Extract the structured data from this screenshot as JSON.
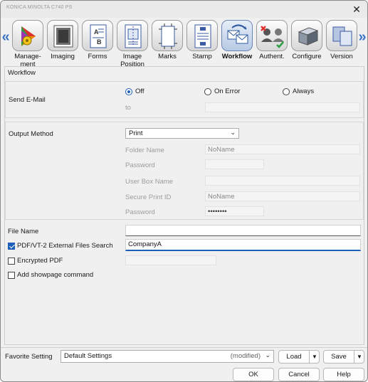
{
  "window": {
    "title": "KONICA MINOLTA C740 PS",
    "close_glyph": "✕"
  },
  "tabs": [
    {
      "label": "Manage-\nment",
      "icon": "management-icon",
      "active": false
    },
    {
      "label": "Imaging",
      "icon": "imaging-icon",
      "active": false
    },
    {
      "label": "Forms",
      "icon": "forms-icon",
      "active": false
    },
    {
      "label": "Image\nPosition",
      "icon": "image-position-icon",
      "active": false
    },
    {
      "label": "Marks",
      "icon": "marks-icon",
      "active": false
    },
    {
      "label": "Stamp",
      "icon": "stamp-icon",
      "active": false
    },
    {
      "label": "Workflow",
      "icon": "workflow-icon",
      "active": true
    },
    {
      "label": "Authent.",
      "icon": "authentication-icon",
      "active": false
    },
    {
      "label": "Configure",
      "icon": "configure-icon",
      "active": false
    },
    {
      "label": "Version",
      "icon": "version-icon",
      "active": false
    }
  ],
  "nav": {
    "left": "«",
    "right": "»"
  },
  "section_title": "Workflow",
  "send_email": {
    "label": "Send E-Mail",
    "options": [
      "Off",
      "On Error",
      "Always"
    ],
    "selected": "Off",
    "to_label": "to",
    "to_value": ""
  },
  "output_method": {
    "label": "Output Method",
    "value": "Print",
    "folder_name_label": "Folder Name",
    "folder_name_value": "NoName",
    "password_label": "Password",
    "password_value": "",
    "user_box_label": "User Box Name",
    "user_box_value": "",
    "secure_print_label": "Secure Print ID",
    "secure_print_value": "NoName",
    "secure_password_label": "Password",
    "secure_password_value": "••••••••"
  },
  "file_name": {
    "label": "File Name",
    "value": ""
  },
  "pdf_search": {
    "label": "PDF/VT-2 External Files Search",
    "checked": true,
    "value": "CompanyA"
  },
  "encrypted_pdf": {
    "label": "Encrypted PDF",
    "checked": false,
    "value": ""
  },
  "showpage": {
    "label": "Add showpage command",
    "checked": false
  },
  "favorite": {
    "label": "Favorite Setting",
    "value": "Default Settings",
    "modified": "(modified)",
    "load_label": "Load",
    "save_label": "Save"
  },
  "buttons": {
    "ok": "OK",
    "cancel": "Cancel",
    "help": "Help"
  },
  "colors": {
    "accent": "#1c5fb8",
    "panel": "#f0f0f0"
  }
}
